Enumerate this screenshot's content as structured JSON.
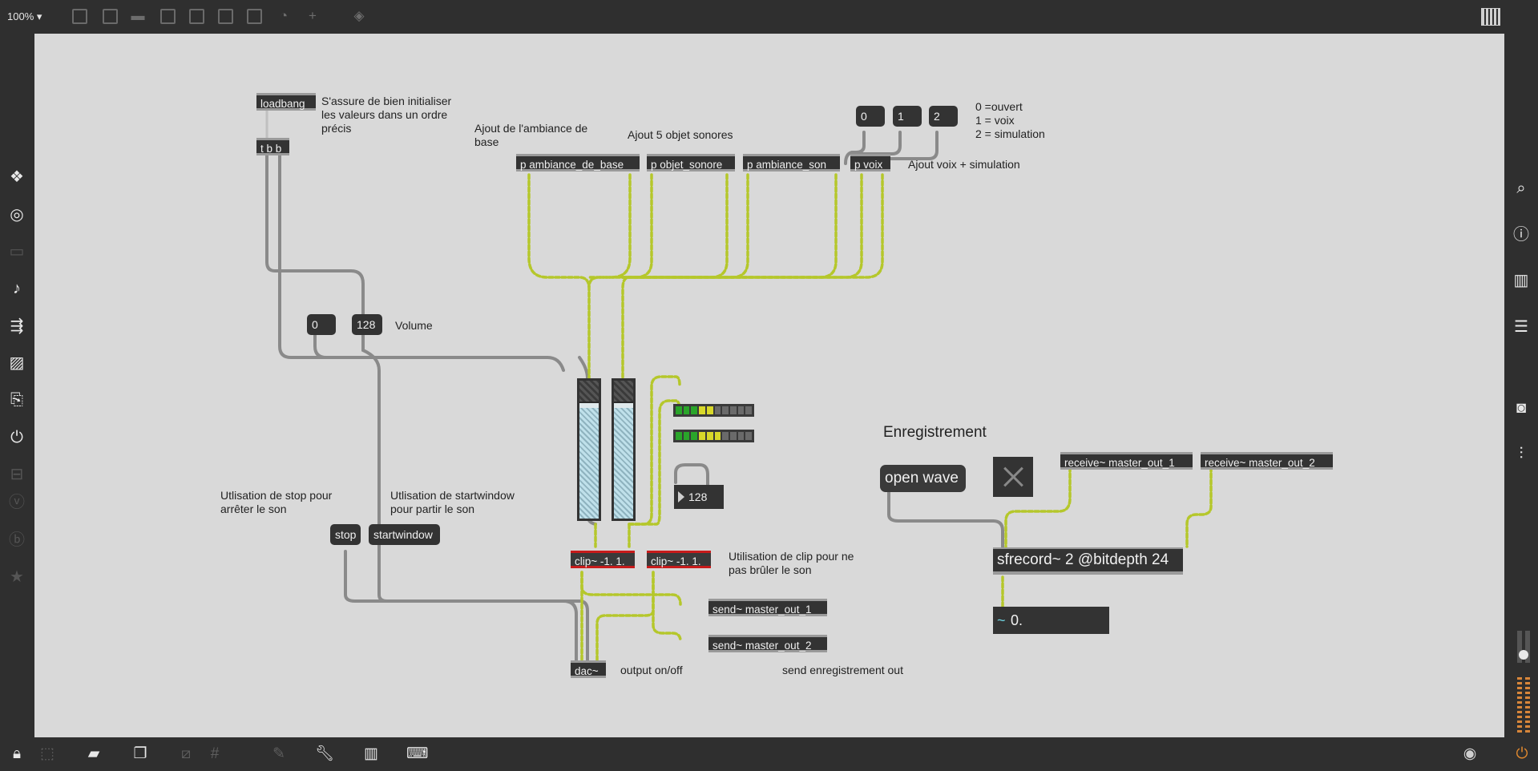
{
  "topbar": {
    "zoom_label": "100% ▾",
    "icons": [
      "presentation-icon",
      "message-icon",
      "comment-icon",
      "toggle-icon",
      "button-icon",
      "bang-icon",
      "slider-icon",
      "dial-icon",
      "plus-icon",
      "paint-icon"
    ]
  },
  "leftbar": {
    "icons": [
      "package-icon",
      "target-icon",
      "window-icon",
      "music-note-icon",
      "playlist-icon",
      "image-icon",
      "paperclip-icon",
      "plug-icon",
      "connector-icon",
      "vst-icon",
      "beap-icon",
      "star-icon"
    ]
  },
  "rightbar": {
    "icons": [
      "search-icon",
      "info-icon",
      "book-icon",
      "list-icon",
      "snapshot-icon",
      "mixer-icon"
    ]
  },
  "bottombar": {
    "icons": [
      "lock-icon",
      "edit-select-icon",
      "presentation-icon",
      "windows-icon",
      "hide-icon",
      "grid-icon",
      "selection-icon",
      "wrench-icon",
      "piano-icon",
      "keyboard-icon",
      "play-icon",
      "power-icon"
    ]
  },
  "patch": {
    "loadbang": "loadbang",
    "loadbang_comment": "S'assure de bien initialiser\nles valeurs dans un ordre\nprécis",
    "tbb": "t b b",
    "comment_ambiance": "Ajout de l'ambiance de\nbase",
    "comment_objets": "Ajout 5 objet sonores",
    "p_ambiance_de_base": "p ambiance_de_base",
    "p_objet_sonore": "p objet_sonore",
    "p_ambiance_son": "p ambiance_son",
    "p_voix": "p voix",
    "msg_0": "0",
    "msg_1": "1",
    "msg_2": "2",
    "voix_legend": "0 =ouvert\n1 = voix\n2 = simulation",
    "voix_comment": "Ajout voix + simulation",
    "vol_0": "0",
    "vol_128": "128",
    "volume_comment": "Volume",
    "number_128": "128",
    "stop_comment": "Utlisation de stop pour\narrêter le son",
    "startwindow_comment": "Utlisation de startwindow\npour partir le son",
    "stop": "stop",
    "startwindow": "startwindow",
    "clip1": "clip~ -1. 1.",
    "clip2": "clip~ -1. 1.",
    "clip_comment": "Utilisation de clip pour ne\npas brûler le son",
    "send1": "send~ master_out_1",
    "send2": "send~ master_out_2",
    "dac": "dac~",
    "dac_comment": "output on/off",
    "send_comment": "send enregistrement out",
    "enregistrement": "Enregistrement",
    "open_wave": "open wave",
    "receive1": "receive~ master_out_1",
    "receive2": "receive~ master_out_2",
    "sfrecord": "sfrecord~ 2 @bitdepth 24",
    "signal_value": "0."
  },
  "colors": {
    "canvas": "#d9d9d9",
    "signal_wire": "#b5c72b",
    "control_wire": "#9a9a9a",
    "object_bg": "#333333"
  }
}
